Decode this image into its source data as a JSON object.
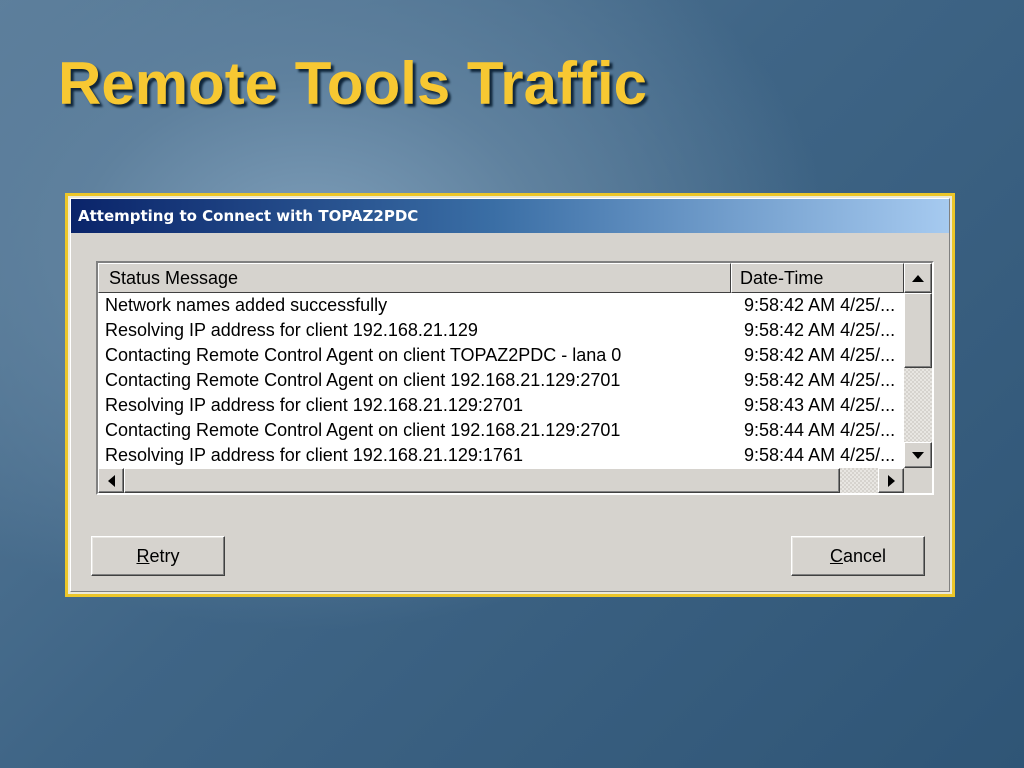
{
  "slide": {
    "title": "Remote Tools Traffic"
  },
  "dialog": {
    "title": "Attempting to Connect with TOPAZ2PDC",
    "columns": {
      "status": "Status Message",
      "date": "Date-Time"
    },
    "rows": [
      {
        "message": "Network names added successfully",
        "datetime": "9:58:42 AM 4/25/..."
      },
      {
        "message": "Resolving IP address for client 192.168.21.129",
        "datetime": "9:58:42 AM 4/25/..."
      },
      {
        "message": "Contacting Remote Control Agent on client TOPAZ2PDC - lana 0",
        "datetime": "9:58:42 AM 4/25/..."
      },
      {
        "message": "Contacting Remote Control Agent on client 192.168.21.129:2701",
        "datetime": "9:58:42 AM 4/25/..."
      },
      {
        "message": "Resolving IP address for client 192.168.21.129:2701",
        "datetime": "9:58:43 AM 4/25/..."
      },
      {
        "message": "Contacting Remote Control Agent on client 192.168.21.129:2701",
        "datetime": "9:58:44 AM 4/25/..."
      },
      {
        "message": "Resolving IP address for client 192.168.21.129:1761",
        "datetime": "9:58:44 AM 4/25/..."
      }
    ],
    "buttons": {
      "retry_mnemonic": "R",
      "retry_rest": "etry",
      "cancel_mnemonic": "C",
      "cancel_rest": "ancel"
    },
    "vscroll": {
      "thumb_fraction": 0.5
    },
    "hscroll": {
      "thumb_fraction": 0.95
    }
  },
  "colors": {
    "title": "#f7c832",
    "frame": "#ecc629",
    "titlebar_start": "#0a246a",
    "titlebar_end": "#a6caf0"
  }
}
